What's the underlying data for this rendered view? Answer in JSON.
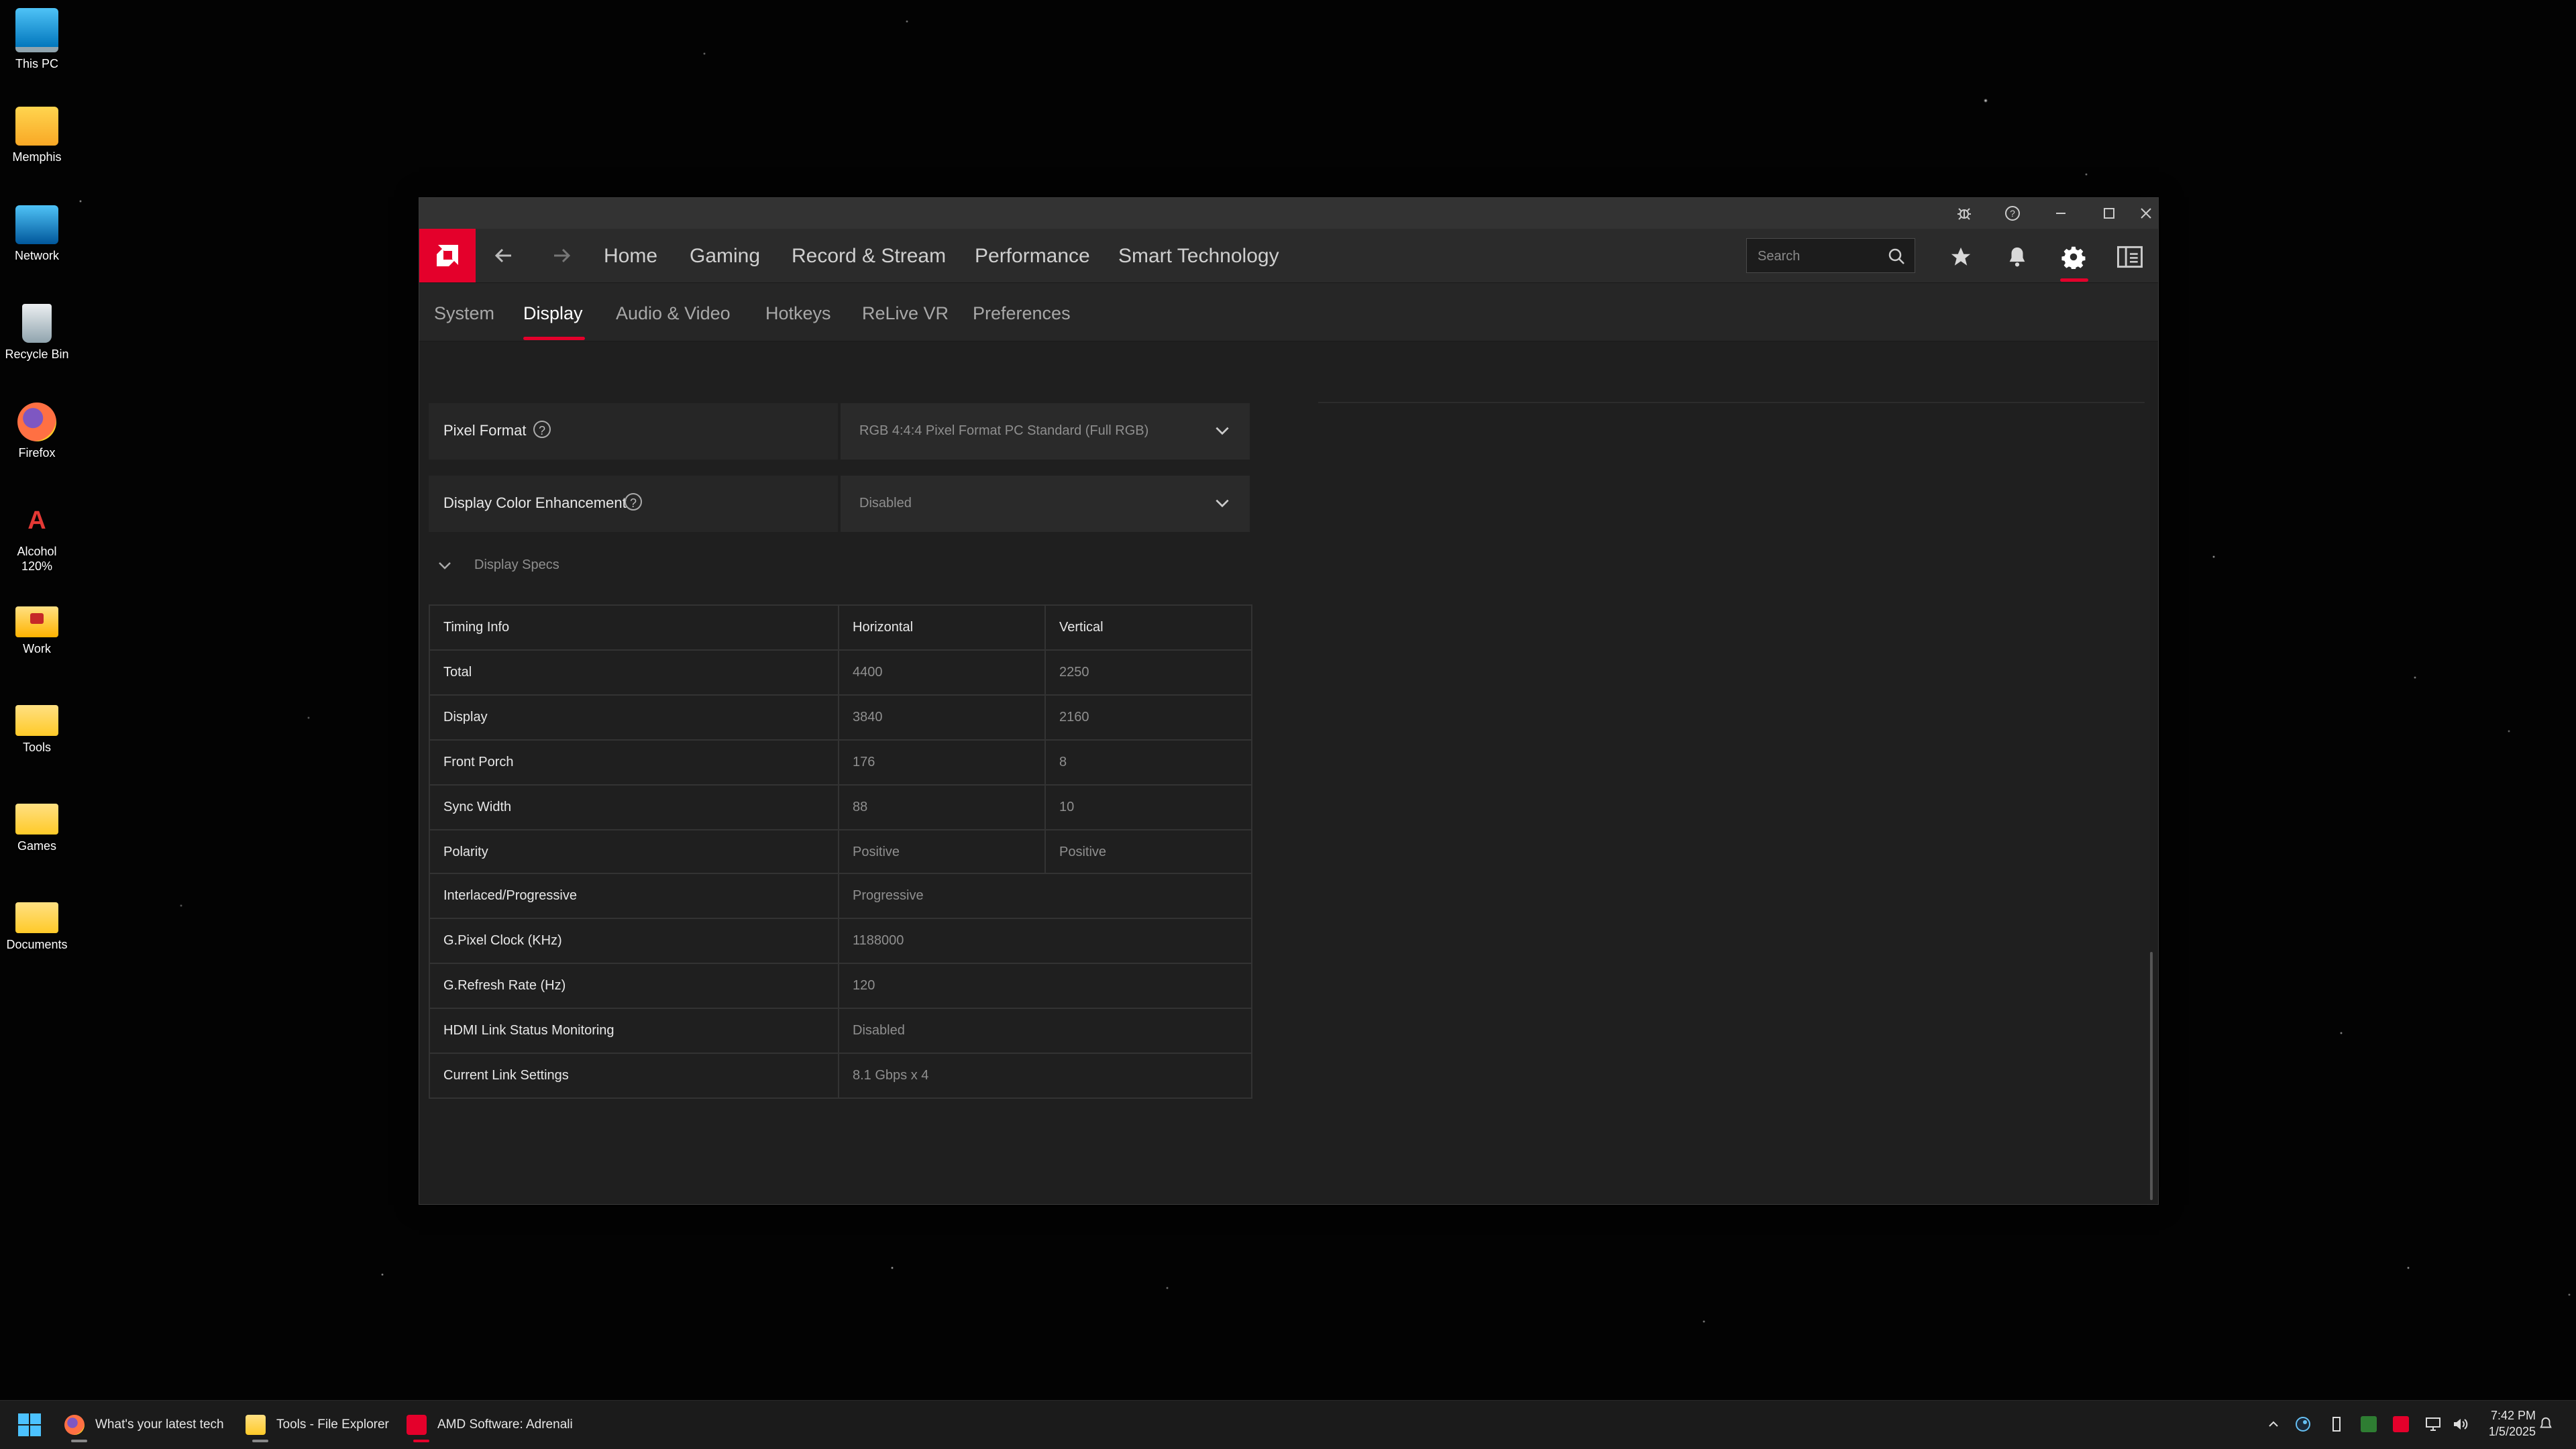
{
  "desktop": {
    "icons": [
      {
        "label": "This PC",
        "icon": "computer-icon"
      },
      {
        "label": "Memphis",
        "icon": "user-folder-icon"
      },
      {
        "label": "Network",
        "icon": "network-icon"
      },
      {
        "label": "Recycle Bin",
        "icon": "recycle-bin-icon"
      },
      {
        "label": "Firefox",
        "icon": "firefox-icon"
      },
      {
        "label": "Alcohol 120%",
        "icon": "alcohol-icon",
        "glyph": "A",
        "label_line1": "Alcohol",
        "label_line2": "120%"
      },
      {
        "label": "Work",
        "icon": "folder-icon"
      },
      {
        "label": "Tools",
        "icon": "folder-icon"
      },
      {
        "label": "Games",
        "icon": "folder-icon"
      },
      {
        "label": "Documents",
        "icon": "folder-icon"
      }
    ]
  },
  "window": {
    "title_buttons": [
      "bug-report-icon",
      "help-icon",
      "minimize-icon",
      "maximize-icon",
      "close-icon"
    ],
    "nav": {
      "items": [
        "Home",
        "Gaming",
        "Record & Stream",
        "Performance",
        "Smart Technology"
      ],
      "search_placeholder": "Search",
      "tools": [
        "favorites-star-icon",
        "notifications-bell-icon",
        "settings-gear-icon",
        "sidebar-toggle-icon"
      ]
    },
    "subnav": {
      "items": [
        "System",
        "Display",
        "Audio & Video",
        "Hotkeys",
        "ReLive VR",
        "Preferences"
      ],
      "active": "Display"
    },
    "settings": [
      {
        "label": "Pixel Format",
        "value": "RGB 4:4:4 Pixel Format PC Standard (Full RGB)"
      },
      {
        "label": "Display Color Enhancement",
        "value": "Disabled"
      }
    ],
    "specs_title": "Display Specs",
    "timing_table": {
      "headers": [
        "Timing Info",
        "Horizontal",
        "Vertical"
      ],
      "rows": [
        [
          "Total",
          "4400",
          "2250"
        ],
        [
          "Display",
          "3840",
          "2160"
        ],
        [
          "Front Porch",
          "176",
          "8"
        ],
        [
          "Sync Width",
          "88",
          "10"
        ],
        [
          "Polarity",
          "Positive",
          "Positive"
        ]
      ]
    },
    "info_table": [
      [
        "Interlaced/Progressive",
        "Progressive"
      ],
      [
        "G.Pixel Clock (KHz)",
        "1188000"
      ],
      [
        "G.Refresh Rate (Hz)",
        "120"
      ],
      [
        "HDMI Link Status Monitoring",
        "Disabled"
      ],
      [
        "Current Link Settings",
        "8.1 Gbps x 4"
      ]
    ]
  },
  "taskbar": {
    "apps": [
      {
        "label": "What's your latest tech",
        "icon": "firefox-icon"
      },
      {
        "label": "Tools - File Explorer",
        "icon": "file-explorer-icon"
      },
      {
        "label": "AMD Software: Adrenali",
        "icon": "amd-icon"
      }
    ],
    "tray": [
      "chevron-up-icon",
      "steam-icon",
      "usb-icon",
      "gpu-temp-icon",
      "amd-tray-icon",
      "network-tray-icon",
      "volume-icon"
    ],
    "time": "7:42 PM",
    "date": "1/5/2025"
  },
  "colors": {
    "accent": "#e4002b",
    "window_bg": "#1f1f1f"
  }
}
